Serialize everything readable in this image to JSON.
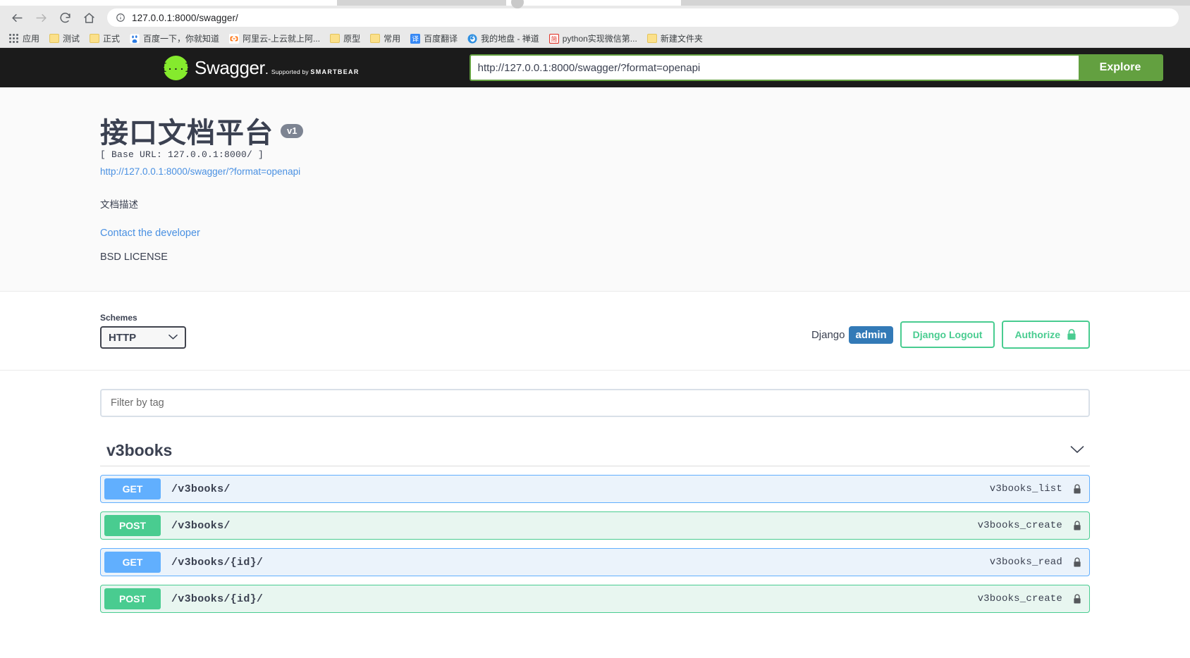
{
  "browser": {
    "nav": {
      "back_icon": "arrow-left-icon",
      "forward_icon": "arrow-right-icon",
      "reload_icon": "reload-icon",
      "home_icon": "home-icon"
    },
    "omnibox": {
      "info_icon": "info-circle-icon",
      "url": "127.0.0.1:8000/swagger/"
    },
    "bookmarks": [
      {
        "label": "应用",
        "icon": "apps-grid-icon"
      },
      {
        "label": "测试",
        "icon": "folder-icon"
      },
      {
        "label": "正式",
        "icon": "folder-icon"
      },
      {
        "label": "百度一下，你就知道",
        "icon": "baidu-icon"
      },
      {
        "label": "阿里云-上云就上阿...",
        "icon": "aliyun-icon"
      },
      {
        "label": "原型",
        "icon": "folder-icon"
      },
      {
        "label": "常用",
        "icon": "folder-icon"
      },
      {
        "label": "百度翻译",
        "icon": "fanyi-icon"
      },
      {
        "label": "我的地盘 - 禅道",
        "icon": "zentao-icon"
      },
      {
        "label": "python实现微信第...",
        "icon": "jian-icon"
      },
      {
        "label": "新建文件夹",
        "icon": "folder-icon"
      }
    ]
  },
  "topbar": {
    "logo_mark": "{...}",
    "logo_name": "Swagger",
    "logo_dot": ".",
    "logo_sub_prefix": "Supported by",
    "logo_sub_brand": "SMARTBEAR",
    "spec_url": "http://127.0.0.1:8000/swagger/?format=openapi",
    "spec_placeholder": "http://127.0.0.1:8000/swagger/?format=openapi",
    "explore_label": "Explore"
  },
  "info": {
    "title": "接口文档平台",
    "version": "v1",
    "base_url": "[ Base URL: 127.0.0.1:8000/ ]",
    "spec_link": "http://127.0.0.1:8000/swagger/?format=openapi",
    "description": "文档描述",
    "contact_label": "Contact the developer",
    "license": "BSD LICENSE"
  },
  "schemes": {
    "label": "Schemes",
    "selected": "HTTP",
    "chevron": "⌄",
    "options": [
      "HTTP"
    ]
  },
  "auth": {
    "django_label": "Django",
    "username": "admin",
    "logout_label": "Django Logout",
    "authorize_label": "Authorize",
    "lock_icon": "lock-icon"
  },
  "operations": {
    "filter_placeholder": "Filter by tag",
    "filter_value": "",
    "tag": "v3books",
    "tag_chevron": "⌄",
    "rows": [
      {
        "method": "GET",
        "path": "/v3books/",
        "summary": "v3books_list",
        "locked": true
      },
      {
        "method": "POST",
        "path": "/v3books/",
        "summary": "v3books_create",
        "locked": true
      },
      {
        "method": "GET",
        "path": "/v3books/{id}/",
        "summary": "v3books_read",
        "locked": true
      },
      {
        "method": "POST",
        "path": "/v3books/{id}/",
        "summary": "v3books_create",
        "locked": true
      }
    ]
  },
  "colors": {
    "swagger_green": "#85ea2d",
    "explore_green": "#63a040",
    "get_blue": "#61affe",
    "post_green": "#49cc90",
    "django_blue": "#337ab7",
    "link_blue": "#4990e2"
  }
}
